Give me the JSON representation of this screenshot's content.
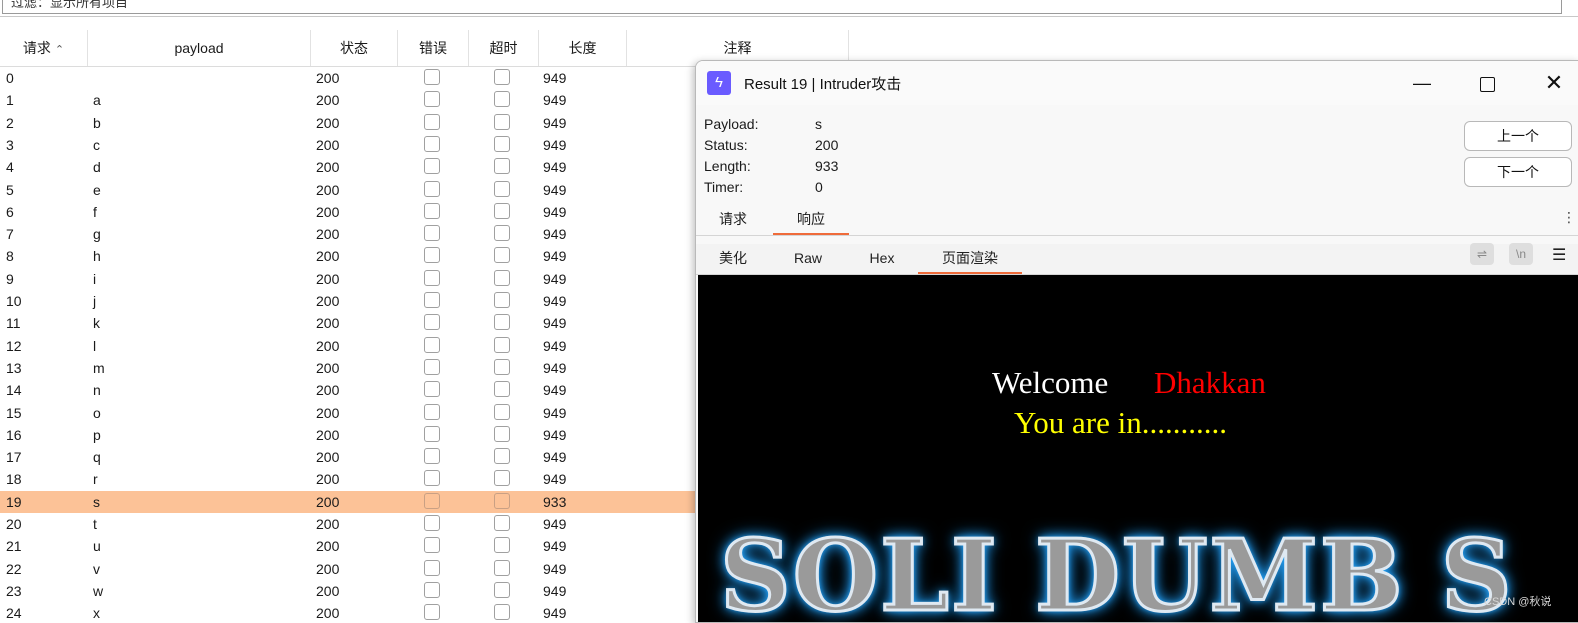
{
  "filter": {
    "text": "过滤：显示所有项目"
  },
  "table": {
    "columns": {
      "id": "请求",
      "sort_indicator": "^",
      "payload": "payload",
      "status": "状态",
      "error": "错误",
      "timeout": "超时",
      "length": "长度",
      "comment": "注释"
    },
    "rows": [
      {
        "id": "0",
        "payload": "",
        "status": "200",
        "length": "949"
      },
      {
        "id": "1",
        "payload": "a",
        "status": "200",
        "length": "949"
      },
      {
        "id": "2",
        "payload": "b",
        "status": "200",
        "length": "949"
      },
      {
        "id": "3",
        "payload": "c",
        "status": "200",
        "length": "949"
      },
      {
        "id": "4",
        "payload": "d",
        "status": "200",
        "length": "949"
      },
      {
        "id": "5",
        "payload": "e",
        "status": "200",
        "length": "949"
      },
      {
        "id": "6",
        "payload": "f",
        "status": "200",
        "length": "949"
      },
      {
        "id": "7",
        "payload": "g",
        "status": "200",
        "length": "949"
      },
      {
        "id": "8",
        "payload": "h",
        "status": "200",
        "length": "949"
      },
      {
        "id": "9",
        "payload": "i",
        "status": "200",
        "length": "949"
      },
      {
        "id": "10",
        "payload": "j",
        "status": "200",
        "length": "949"
      },
      {
        "id": "11",
        "payload": "k",
        "status": "200",
        "length": "949"
      },
      {
        "id": "12",
        "payload": "l",
        "status": "200",
        "length": "949"
      },
      {
        "id": "13",
        "payload": "m",
        "status": "200",
        "length": "949"
      },
      {
        "id": "14",
        "payload": "n",
        "status": "200",
        "length": "949"
      },
      {
        "id": "15",
        "payload": "o",
        "status": "200",
        "length": "949"
      },
      {
        "id": "16",
        "payload": "p",
        "status": "200",
        "length": "949"
      },
      {
        "id": "17",
        "payload": "q",
        "status": "200",
        "length": "949"
      },
      {
        "id": "18",
        "payload": "r",
        "status": "200",
        "length": "949"
      },
      {
        "id": "19",
        "payload": "s",
        "status": "200",
        "length": "933",
        "selected": true
      },
      {
        "id": "20",
        "payload": "t",
        "status": "200",
        "length": "949"
      },
      {
        "id": "21",
        "payload": "u",
        "status": "200",
        "length": "949"
      },
      {
        "id": "22",
        "payload": "v",
        "status": "200",
        "length": "949"
      },
      {
        "id": "23",
        "payload": "w",
        "status": "200",
        "length": "949"
      },
      {
        "id": "24",
        "payload": "x",
        "status": "200",
        "length": "949"
      }
    ],
    "selected_color": "#fcc297"
  },
  "result_window": {
    "title": "Result 19 | Intruder攻击",
    "icon": "lightning-icon",
    "controls": {
      "minimize": "—",
      "close": "✕"
    },
    "info": [
      {
        "label": "Payload:",
        "value": "s"
      },
      {
        "label": "Status:",
        "value": "200"
      },
      {
        "label": "Length:",
        "value": "933"
      },
      {
        "label": "Timer:",
        "value": "0"
      }
    ],
    "prev_button": "上一个",
    "next_button": "下一个",
    "tabs": {
      "request": "请求",
      "response": "响应",
      "active": "响应"
    },
    "view_tabs": {
      "pretty": "美化",
      "raw": "Raw",
      "hex": "Hex",
      "render": "页面渲染",
      "active": "页面渲染"
    },
    "tools": {
      "wrap": "⇌",
      "newline": "\\n",
      "menu": "☰"
    },
    "accent_color": "#ef6b3a",
    "render": {
      "welcome": "Welcome",
      "name": "Dhakkan",
      "message": "You are in...........",
      "banner": "SOLI DUMB S"
    }
  },
  "watermark": "CSDN @秋说"
}
